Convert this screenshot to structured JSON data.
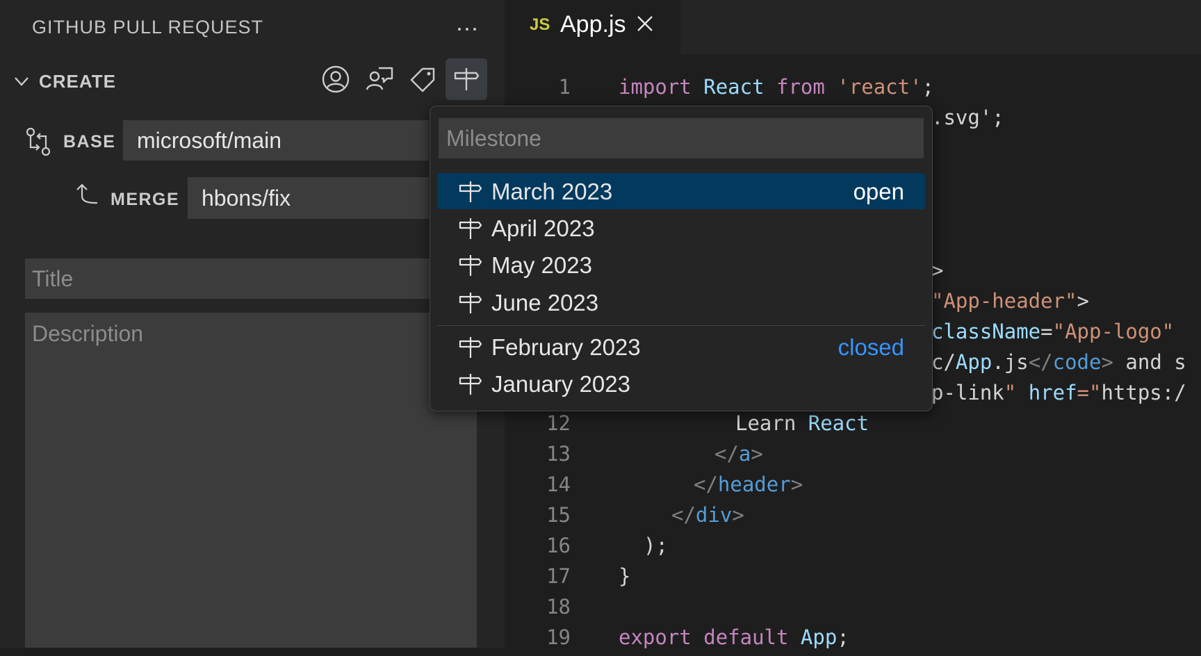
{
  "sidebar": {
    "header": "GITHUB PULL REQUEST",
    "section_title": "CREATE",
    "toolbar": {
      "assignees_icon": "person-circle-icon",
      "reviewers_icon": "reviewers-icon",
      "labels_icon": "tag-icon",
      "milestone_icon": "milestone-icon"
    },
    "base": {
      "label": "BASE",
      "value": "microsoft/main"
    },
    "merge": {
      "label": "MERGE",
      "value": "hbons/fix"
    },
    "title_placeholder": "Title",
    "description_placeholder": "Description"
  },
  "editor": {
    "tab": {
      "badge": "JS",
      "label": "App.js"
    },
    "lines": [
      {
        "n": "1",
        "text": "import React from 'react';"
      },
      {
        "n": "",
        "text": ".svg';"
      },
      {
        "n": "",
        "text": ">"
      },
      {
        "n": "",
        "text": "\"App-header\">"
      },
      {
        "n": "",
        "text": "className=\"App-logo\""
      },
      {
        "n": "",
        "text": "c/App.js</code> and s"
      },
      {
        "n": "",
        "text": "p-link\" href=\"https:/"
      },
      {
        "n": "12",
        "text": "Learn React"
      },
      {
        "n": "13",
        "text": "</a>"
      },
      {
        "n": "14",
        "text": "</header>"
      },
      {
        "n": "15",
        "text": "</div>"
      },
      {
        "n": "16",
        "text": ");"
      },
      {
        "n": "17",
        "text": "}"
      },
      {
        "n": "18",
        "text": ""
      },
      {
        "n": "19",
        "text": "export default App;"
      }
    ]
  },
  "milestone_picker": {
    "placeholder": "Milestone",
    "items": [
      {
        "label": "March 2023",
        "badge": "open"
      },
      {
        "label": "April 2023",
        "badge": ""
      },
      {
        "label": "May 2023",
        "badge": ""
      },
      {
        "label": "June 2023",
        "badge": ""
      },
      {
        "label": "February 2023",
        "badge": "closed"
      },
      {
        "label": "January 2023",
        "badge": ""
      }
    ]
  },
  "colors": {
    "selection": "#04395e",
    "closed_badge": "#3794ff",
    "js_badge": "#cbcb41",
    "keyword": "#c586c0",
    "string": "#ce9178",
    "tag": "#569cd6",
    "attribute": "#9cdcfe",
    "identifier": "#4ec9b0"
  }
}
